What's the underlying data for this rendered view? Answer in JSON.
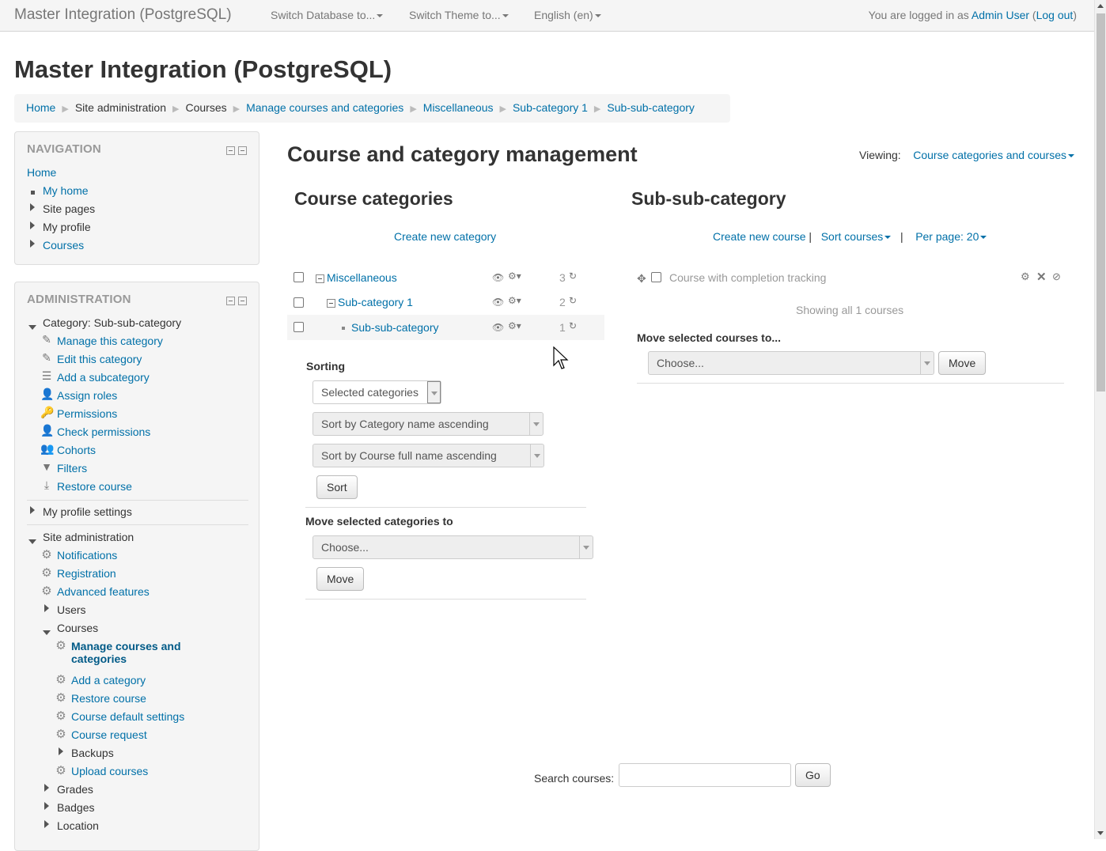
{
  "navbar": {
    "brand": "Master Integration (PostgreSQL)",
    "menus": [
      "Switch Database to...",
      "Switch Theme to...",
      "English (en)"
    ],
    "login_prefix": "You are logged in as ",
    "user": "Admin User",
    "logout": "Log out"
  },
  "page": {
    "site_title": "Master Integration (PostgreSQL)",
    "heading": "Course and category management",
    "viewing_label": "Viewing:",
    "viewing_value": "Course categories and courses"
  },
  "breadcrumb": [
    "Home",
    "Site administration",
    "Courses",
    "Manage courses and categories",
    "Miscellaneous",
    "Sub-category 1",
    "Sub-sub-category"
  ],
  "navigation": {
    "title": "NAVIGATION",
    "home": "Home",
    "items": [
      "My home",
      "Site pages",
      "My profile",
      "Courses"
    ]
  },
  "administration": {
    "title": "ADMINISTRATION",
    "category_node": "Category: Sub-sub-category",
    "category_items": [
      "Manage this category",
      "Edit this category",
      "Add a subcategory",
      "Assign roles",
      "Permissions",
      "Check permissions",
      "Cohorts",
      "Filters",
      "Restore course"
    ],
    "my_profile_settings": "My profile settings",
    "site_admin": "Site administration",
    "site_admin_items": [
      "Notifications",
      "Registration",
      "Advanced features",
      "Users",
      "Courses"
    ],
    "courses_items": [
      "Manage courses and",
      "categories",
      "Add a category",
      "Restore course",
      "Course default settings",
      "Course request",
      "Backups",
      "Upload courses"
    ],
    "tail_items": [
      "Grades",
      "Badges",
      "Location"
    ]
  },
  "categories": {
    "heading": "Course categories",
    "create_link": "Create new category",
    "rows": [
      {
        "name": "Miscellaneous",
        "count": "3"
      },
      {
        "name": "Sub-category 1",
        "count": "2"
      },
      {
        "name": "Sub-sub-category",
        "count": "1"
      }
    ],
    "sorting_label": "Sorting",
    "sort_scope": "Selected categories",
    "sort_cat": "Sort by Category name ascending",
    "sort_course": "Sort by Course full name ascending",
    "sort_button": "Sort",
    "move_label": "Move selected categories to",
    "move_select": "Choose...",
    "move_button": "Move"
  },
  "courses": {
    "heading": "Sub-sub-category",
    "create_link": "Create new course",
    "sort_link": "Sort courses",
    "per_page": "Per page: 20",
    "course_name": "Course with completion tracking",
    "showing": "Showing all 1 courses",
    "move_label": "Move selected courses to...",
    "move_select": "Choose...",
    "move_button": "Move"
  },
  "search": {
    "label": "Search courses:",
    "button": "Go"
  }
}
